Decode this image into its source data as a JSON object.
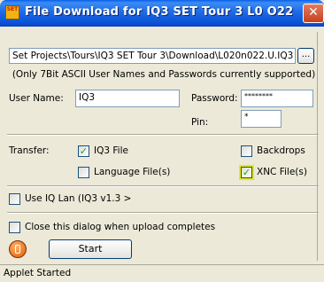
{
  "window": {
    "title": "File Download for IQ3 SET Tour 3 L0 O22",
    "icon": "set-app-icon",
    "icon_text": "SET",
    "close_glyph": "✕"
  },
  "download": {
    "path": "Set Projects\\Tours\\IQ3 SET Tour 3\\Download\\L020n022.U.IQ3",
    "browse_label": "...",
    "note": "(Only 7Bit ASCII User Names and Passwords currently supported)"
  },
  "credentials": {
    "username_label": "User Name:",
    "username_value": "IQ3",
    "password_label": "Password:",
    "password_value": "********",
    "pin_label": "Pin:",
    "pin_value": "*"
  },
  "transfer": {
    "label": "Transfer:",
    "options": [
      {
        "label": "IQ3 File",
        "checked": true
      },
      {
        "label": "Language File(s)",
        "checked": false
      },
      {
        "label": "Backdrops",
        "checked": false
      },
      {
        "label": "XNC File(s)",
        "checked": true,
        "highlighted": true
      }
    ]
  },
  "iq_lan": {
    "label": "Use IQ  Lan (IQ3 v1.3 >",
    "checked": false
  },
  "close_when_done": {
    "label": "Close this dialog when upload completes",
    "checked": false
  },
  "start_label": "Start",
  "status": "Applet Started",
  "check_glyph": "✓",
  "colors": {
    "title_blue": "#0a5ee8",
    "face": "#ece9d8",
    "check_green": "#21a121",
    "highlight": "#e8e800",
    "close_red": "#c6411f"
  }
}
